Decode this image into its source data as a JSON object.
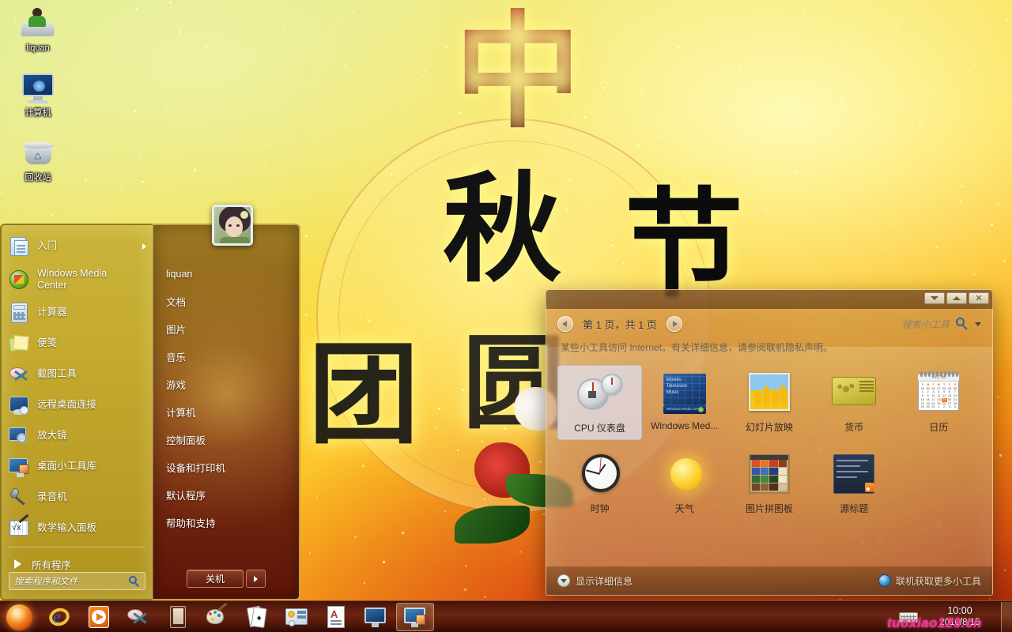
{
  "desktop": {
    "icons": [
      {
        "label": "liquan",
        "icon": "user-folder-icon"
      },
      {
        "label": "计算机",
        "icon": "computer-icon"
      },
      {
        "label": "回收站",
        "icon": "recycle-bin-icon"
      }
    ]
  },
  "start_menu": {
    "programs": [
      {
        "label": "入门",
        "icon": "getting-started-icon",
        "has_submenu": true
      },
      {
        "label": "Windows Media Center",
        "icon": "windows-media-center-icon",
        "has_submenu": false
      },
      {
        "label": "计算器",
        "icon": "calculator-icon",
        "has_submenu": false
      },
      {
        "label": "便笺",
        "icon": "sticky-notes-icon",
        "has_submenu": false
      },
      {
        "label": "截图工具",
        "icon": "snipping-tool-icon",
        "has_submenu": false
      },
      {
        "label": "远程桌面连接",
        "icon": "remote-desktop-icon",
        "has_submenu": false
      },
      {
        "label": "放大镜",
        "icon": "magnifier-icon",
        "has_submenu": false
      },
      {
        "label": "桌面小工具库",
        "icon": "desktop-gadget-gallery-icon",
        "has_submenu": false
      },
      {
        "label": "录音机",
        "icon": "sound-recorder-icon",
        "has_submenu": false
      },
      {
        "label": "数学输入面板",
        "icon": "math-input-panel-icon",
        "has_submenu": false
      }
    ],
    "all_programs_label": "所有程序",
    "search_placeholder": "搜索程序和文件",
    "user_name": "liquan",
    "right_links": [
      "文档",
      "图片",
      "音乐",
      "游戏",
      "计算机",
      "控制面板",
      "设备和打印机",
      "默认程序",
      "帮助和支持"
    ],
    "shutdown_label": "关机"
  },
  "gadget_window": {
    "page_label": "第 1 页，共 1 页",
    "search_placeholder": "搜索小工具",
    "notice": "某些小工具访问 Internet。有关详细信息，请参阅联机隐私声明。",
    "details_label": "显示详细信息",
    "more_gadgets_label": "联机获取更多小工具",
    "window_controls": {
      "minimize": "minimize-icon",
      "restore": "restore-icon",
      "close": "close-icon"
    },
    "gadgets": [
      {
        "name": "CPU 仪表盘",
        "thumb": "cpu-meter-thumb",
        "selected": true
      },
      {
        "name": "Windows Med...",
        "thumb": "windows-media-center-thumb",
        "selected": false
      },
      {
        "name": "幻灯片放映",
        "thumb": "slideshow-thumb",
        "selected": false
      },
      {
        "name": "货币",
        "thumb": "currency-thumb",
        "selected": false
      },
      {
        "name": "日历",
        "thumb": "calendar-thumb",
        "selected": false
      },
      {
        "name": "时钟",
        "thumb": "clock-thumb",
        "selected": false
      },
      {
        "name": "天气",
        "thumb": "weather-thumb",
        "selected": false
      },
      {
        "name": "图片拼图板",
        "thumb": "picture-puzzle-thumb",
        "selected": false
      },
      {
        "name": "源标题",
        "thumb": "feed-headlines-thumb",
        "selected": false
      }
    ],
    "calendar_thumb": {
      "month": "OCT 06",
      "weekdays": [
        "S",
        "M",
        "T",
        "W",
        "T",
        "F",
        "S"
      ],
      "weeks": [
        [
          "29",
          "30",
          "26",
          "27",
          "28",
          "29",
          "30"
        ],
        [
          "1",
          "2",
          "3",
          "4",
          "5",
          "6",
          "7"
        ],
        [
          "8",
          "9",
          "10",
          "11",
          "12",
          "13",
          "14"
        ],
        [
          "15",
          "16",
          "17",
          "18",
          "19",
          "20",
          "21"
        ],
        [
          "22",
          "23",
          "24",
          "25",
          "26",
          "27",
          "28"
        ],
        [
          "29",
          "30",
          "31",
          "1",
          "2",
          "3",
          "4"
        ]
      ],
      "highlight": {
        "week": 3,
        "day": 4
      }
    },
    "wmc_thumb_lines": [
      "Movies",
      "Television",
      "Music"
    ],
    "wmc_thumb_bar": "Windows Media Center"
  },
  "taskbar": {
    "start_orb": "start-orb-icon",
    "items": [
      {
        "icon": "internet-explorer-icon",
        "active": false
      },
      {
        "icon": "windows-media-player-icon",
        "active": false
      },
      {
        "icon": "snipping-tool-icon",
        "active": false
      },
      {
        "icon": "book-reader-icon",
        "active": false
      },
      {
        "icon": "paint-icon",
        "active": false
      },
      {
        "icon": "solitaire-icon",
        "active": false
      },
      {
        "icon": "control-panel-icon",
        "active": false
      },
      {
        "icon": "wordpad-icon",
        "active": false
      },
      {
        "icon": "computer-icon",
        "active": false
      },
      {
        "icon": "desktop-gadget-gallery-icon",
        "active": true
      }
    ],
    "tray": {
      "keyboard_icon": "keyboard-icon",
      "time": "10:00",
      "date": "2010/8/15"
    },
    "show_desktop": "show-desktop-button"
  },
  "watermark": "tuoxiao123.cn",
  "colors": {
    "wallpaper_gold": "#fcd93a",
    "wallpaper_orange": "#f58d14",
    "taskbar_dark_red": "#541a0c",
    "start_menu_gold": "#c5ab2f",
    "start_menu_right": "#7a2f12",
    "selection_lavender": "#e1e1f5",
    "watermark_pink": "#ff2e9a"
  }
}
